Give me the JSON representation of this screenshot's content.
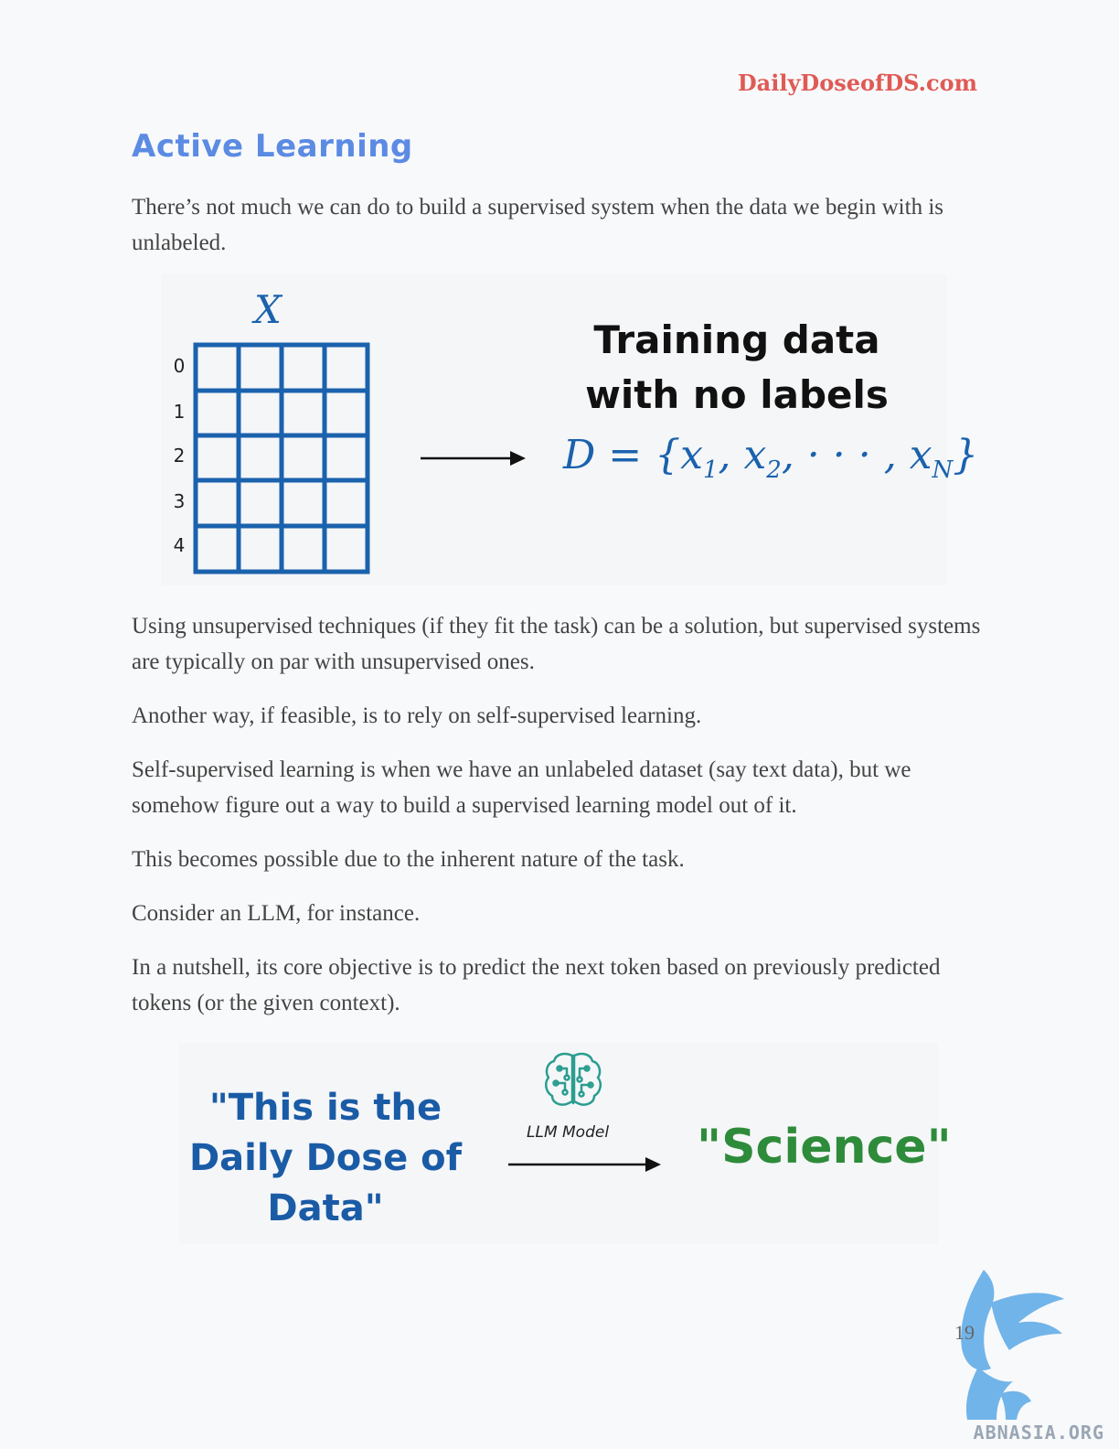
{
  "header": {
    "site": "DailyDoseofDS.com"
  },
  "section": {
    "title": "Active Learning"
  },
  "paragraphs": [
    "There’s not much we can do to build a supervised system when the data we begin with is unlabeled.",
    "Using unsupervised techniques (if they fit the task) can be a solution, but supervised systems are typically on par with unsupervised ones.",
    "Another way, if feasible, is to rely on self-supervised learning.",
    "Self-supervised learning is when we have an unlabeled dataset (say text data), but we somehow figure out a way to build a supervised learning model out of it.",
    "This becomes possible due to the inherent nature of the task.",
    "Consider an LLM, for instance.",
    "In a nutshell, its core objective is to predict the next token based on previously predicted tokens (or the given context)."
  ],
  "figure1": {
    "matrix_label": "X",
    "row_labels": [
      "0",
      "1",
      "2",
      "3",
      "4"
    ],
    "caption_line1": "Training data",
    "caption_line2": "with no labels",
    "formula_prefix": "D = {x",
    "sub1": "1",
    "mid1": ", x",
    "sub2": "2",
    "mid2": ", · · · , x",
    "subN": "N",
    "suffix": "}"
  },
  "figure2": {
    "input_line1": "\"This is the",
    "input_line2": "Daily Dose of",
    "input_line3": "Data\"",
    "model_label": "LLM Model",
    "output": "\"Science\""
  },
  "footer": {
    "page_number": "19",
    "watermark": "ABNASIA.ORG"
  },
  "colors": {
    "heading": "#5b8be3",
    "site": "#e05a55",
    "diagram_blue": "#1a62ad",
    "science_green": "#2e8b3a",
    "brain_teal": "#2a9d8f"
  }
}
